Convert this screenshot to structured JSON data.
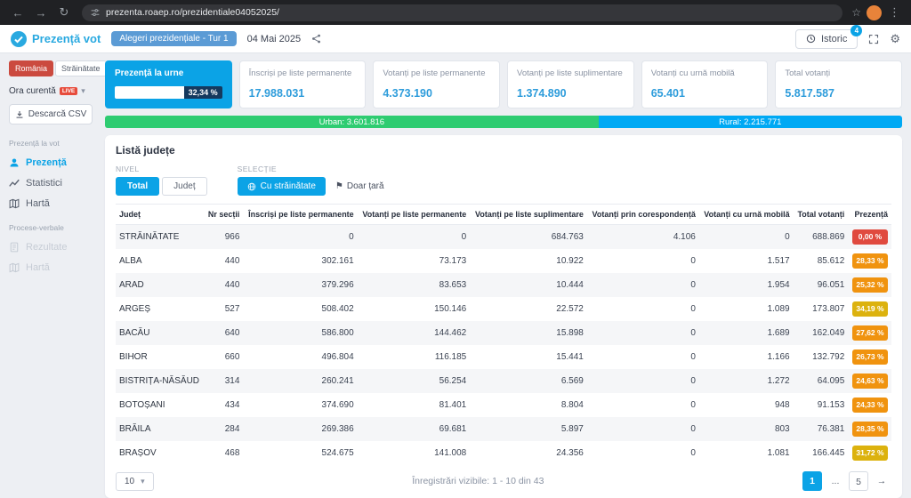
{
  "browser": {
    "url": "prezenta.roaep.ro/prezidentiale04052025/"
  },
  "icons": {
    "back": "←",
    "forward": "→",
    "refresh": "↻",
    "star": "☆",
    "menu_dots": "⋮",
    "caret_down": "▾",
    "gear": "⚙",
    "flag": "⚑",
    "next_page": "→"
  },
  "header": {
    "logo_text": "Prezență vot",
    "election_badge": "Alegeri prezidențiale - Tur 1",
    "date": "04 Mai 2025",
    "istoric": {
      "label": "Istoric",
      "badge": "4"
    }
  },
  "sidebar": {
    "country_tabs": [
      {
        "label": "România",
        "active": true
      },
      {
        "label": "Străinătate",
        "active": false
      }
    ],
    "time_filter": {
      "label": "Ora curentă",
      "live": "LIVE"
    },
    "download_csv": "Descarcă CSV",
    "section_prezenta": {
      "title": "Prezență la vot",
      "items": [
        {
          "label": "Prezență",
          "active": true
        },
        {
          "label": "Statistici",
          "active": false
        },
        {
          "label": "Hartă",
          "active": false
        }
      ]
    },
    "section_procese": {
      "title": "Procese-verbale",
      "items": [
        {
          "label": "Rezultate",
          "disabled": true
        },
        {
          "label": "Hartă",
          "disabled": true
        }
      ]
    }
  },
  "cards": {
    "turnout": {
      "label": "Prezență la urne",
      "percent_label": "32,34 %"
    },
    "stats": [
      {
        "label": "Înscriși pe liste permanente",
        "value": "17.988.031"
      },
      {
        "label": "Votanți pe liste permanente",
        "value": "4.373.190"
      },
      {
        "label": "Votanți pe liste suplimentare",
        "value": "1.374.890"
      },
      {
        "label": "Votanți cu urnă mobilă",
        "value": "65.401"
      },
      {
        "label": "Total votanți",
        "value": "5.817.587"
      }
    ]
  },
  "urban_rural": {
    "urban": "Urban: 3.601.816",
    "rural": "Rural: 2.215.771",
    "urban_percent": 61.9
  },
  "table_panel": {
    "title": "Listă județe",
    "nivel": {
      "label": "NIVEL",
      "options": [
        "Total",
        "Județ"
      ]
    },
    "selectie": {
      "label": "SELECȚIE",
      "options": [
        "Cu străinătate",
        "Doar țară"
      ]
    },
    "columns": [
      "Județ",
      "Nr secții",
      "Înscriși pe liste permanente",
      "Votanți pe liste permanente",
      "Votanți pe liste suplimentare",
      "Votanți prin corespondență",
      "Votanți cu urnă mobilă",
      "Total votanți",
      "Prezență"
    ],
    "rows": [
      {
        "cells": [
          "STRĂINĂTATE",
          "966",
          "0",
          "0",
          "684.763",
          "4.106",
          "0",
          "688.869"
        ],
        "prezenta": "0,00 %",
        "badge": "red"
      },
      {
        "cells": [
          "ALBA",
          "440",
          "302.161",
          "73.173",
          "10.922",
          "0",
          "1.517",
          "85.612"
        ],
        "prezenta": "28,33 %",
        "badge": "orange"
      },
      {
        "cells": [
          "ARAD",
          "440",
          "379.296",
          "83.653",
          "10.444",
          "0",
          "1.954",
          "96.051"
        ],
        "prezenta": "25,32 %",
        "badge": "orange"
      },
      {
        "cells": [
          "ARGEȘ",
          "527",
          "508.402",
          "150.146",
          "22.572",
          "0",
          "1.089",
          "173.807"
        ],
        "prezenta": "34,19 %",
        "badge": "yellow"
      },
      {
        "cells": [
          "BACĂU",
          "640",
          "586.800",
          "144.462",
          "15.898",
          "0",
          "1.689",
          "162.049"
        ],
        "prezenta": "27,62 %",
        "badge": "orange"
      },
      {
        "cells": [
          "BIHOR",
          "660",
          "496.804",
          "116.185",
          "15.441",
          "0",
          "1.166",
          "132.792"
        ],
        "prezenta": "26,73 %",
        "badge": "orange"
      },
      {
        "cells": [
          "BISTRIȚA-NĂSĂUD",
          "314",
          "260.241",
          "56.254",
          "6.569",
          "0",
          "1.272",
          "64.095"
        ],
        "prezenta": "24,63 %",
        "badge": "orange"
      },
      {
        "cells": [
          "BOTOȘANI",
          "434",
          "374.690",
          "81.401",
          "8.804",
          "0",
          "948",
          "91.153"
        ],
        "prezenta": "24,33 %",
        "badge": "orange"
      },
      {
        "cells": [
          "BRĂILA",
          "284",
          "269.386",
          "69.681",
          "5.897",
          "0",
          "803",
          "76.381"
        ],
        "prezenta": "28,35 %",
        "badge": "orange"
      },
      {
        "cells": [
          "BRAȘOV",
          "468",
          "524.675",
          "141.008",
          "24.356",
          "0",
          "1.081",
          "166.445"
        ],
        "prezenta": "31,72 %",
        "badge": "yellow"
      }
    ],
    "footer": {
      "page_size": "10",
      "visible_info": "Înregistrări vizibile: 1 - 10 din 43",
      "pages": [
        {
          "label": "1",
          "active": true
        },
        {
          "label": "..."
        },
        {
          "label": "5"
        }
      ]
    }
  },
  "colors": {
    "accent_blue": "#0ba3e6",
    "value_blue": "#2d9cdb",
    "election_badge_blue": "#5b9bd5",
    "urban_green": "#2ecc71",
    "rural_blue": "#00a9f4",
    "romania_red": "#cb4a3f",
    "live_red": "#e74c3c",
    "progress_navy": "#15395e",
    "badge_red": "#e04a3f",
    "badge_orange": "#f0930f",
    "badge_yellow": "#dcb20e"
  }
}
